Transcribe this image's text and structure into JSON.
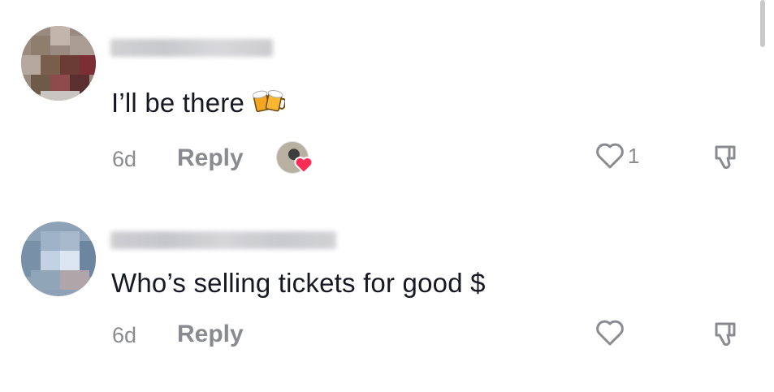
{
  "comments": [
    {
      "text": "I’ll be there",
      "emoji": "beer-mugs-icon",
      "age": "6d",
      "reply_label": "Reply",
      "liked_by_creator": true,
      "like_count": "1"
    },
    {
      "text": "Who’s selling tickets for good $",
      "age": "6d",
      "reply_label": "Reply",
      "liked_by_creator": false,
      "like_count": ""
    }
  ],
  "colors": {
    "text": "#161823",
    "secondary": "#8a8b91",
    "heart_accent": "#fe2c55"
  }
}
